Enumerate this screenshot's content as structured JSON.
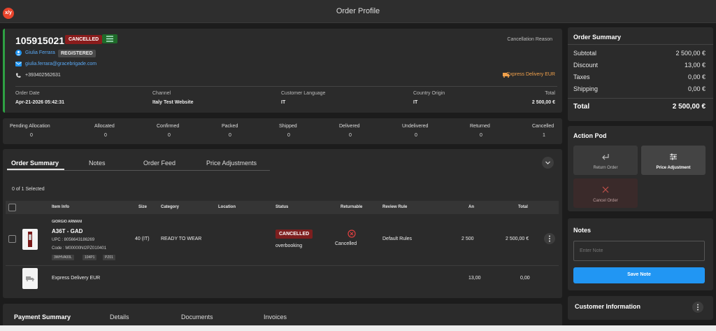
{
  "header": {
    "logo": "x/y",
    "title": "Order Profile"
  },
  "order": {
    "id": "105915021",
    "status": "CANCELLED",
    "cancellation_label": "Cancellation Reason",
    "customer_name": "Giulia Ferrara",
    "customer_status": "REGISTERED",
    "email": "giulia.ferrara@gracebrigade.com",
    "phone": "+393402562631",
    "delivery": "Express Delivery EUR",
    "fields": [
      {
        "label": "Order Date",
        "value": "Apr-21-2026 05:42:31"
      },
      {
        "label": "Channel",
        "value": "Italy Test Website"
      },
      {
        "label": "Customer Language",
        "value": "IT"
      },
      {
        "label": "Country Origin",
        "value": "IT"
      },
      {
        "label": "Total",
        "value": "2 500,00 €"
      }
    ]
  },
  "counts": [
    {
      "label": "Pending Allocation",
      "value": "0"
    },
    {
      "label": "Allocated",
      "value": "0"
    },
    {
      "label": "Confirmed",
      "value": "0"
    },
    {
      "label": "Packed",
      "value": "0"
    },
    {
      "label": "Shipped",
      "value": "0"
    },
    {
      "label": "Delivered",
      "value": "0"
    },
    {
      "label": "Undelivered",
      "value": "0"
    },
    {
      "label": "Returned",
      "value": "0"
    },
    {
      "label": "Cancelled",
      "value": "1"
    }
  ],
  "tabs": [
    "Order Summary",
    "Notes",
    "Order Feed",
    "Price Adjustments"
  ],
  "selected_text": "0 of 1 Selected",
  "table": {
    "headers": [
      "Item Info",
      "Size",
      "Category",
      "Location",
      "Status",
      "Returnable",
      "Review Rule",
      "An",
      "Total"
    ],
    "item": {
      "brand": "GIORGIO ARMANI",
      "name": "A36T - GAD",
      "upc": "UPC : 8056643186269",
      "code": "Code : M00000NI2PZ010401",
      "tags": [
        "3WHVA00L",
        "104P1",
        "PZ01"
      ],
      "size": "40 (IT)",
      "category": "READY TO WEAR",
      "status": "CANCELLED",
      "status_reason": "overbooking",
      "returnable": "Cancelled",
      "review_rule": "Default Rules",
      "amount": "2 500",
      "total": "2 500,00 €"
    },
    "shipping": {
      "name": "Express Delivery EUR",
      "amount": "13,00",
      "total": "0,00"
    }
  },
  "bottom_tabs": [
    "Payment Summary",
    "Details",
    "Documents",
    "Invoices"
  ],
  "summary": {
    "title": "Order Summary",
    "rows": [
      {
        "label": "Subtotal",
        "value": "2 500,00 €"
      },
      {
        "label": "Discount",
        "value": "13,00 €"
      },
      {
        "label": "Taxes",
        "value": "0,00 €"
      },
      {
        "label": "Shipping",
        "value": "0,00 €"
      }
    ],
    "total_label": "Total",
    "total_value": "2 500,00 €"
  },
  "actions": {
    "title": "Action Pod",
    "return": "Return Order",
    "price": "Price Adjustment",
    "cancel": "Cancel Order"
  },
  "notes": {
    "title": "Notes",
    "placeholder": "Enter Note",
    "save": "Save Note"
  },
  "customer_info": {
    "title": "Customer Information"
  },
  "colors": {
    "accent": "#2196f3",
    "green": "#2ea043",
    "red": "#8a1c1c",
    "delivery": "#f0a04b"
  }
}
